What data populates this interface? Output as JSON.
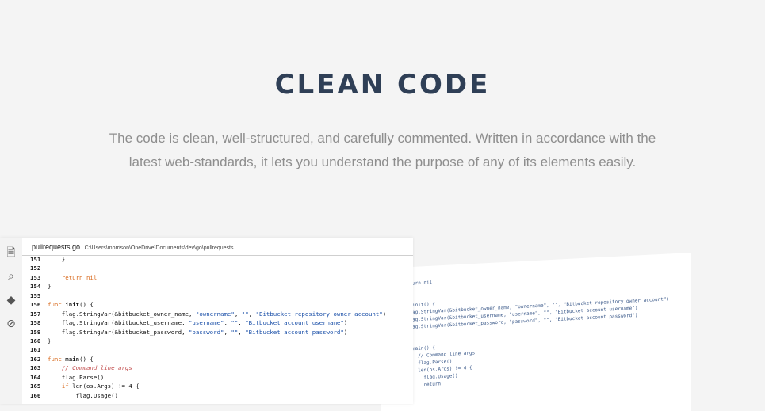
{
  "hero": {
    "title": "CLEAN CODE",
    "description": "The code is clean, well-structured, and carefully commented. Written in accordance with the latest web-standards, it lets you understand the purpose of any of its elements easily."
  },
  "editor": {
    "file_name": "pullrequests.go",
    "file_path": "C:\\Users\\morrison\\OneDrive\\Documents\\dev\\go\\pullrequests",
    "activity_icons": [
      "files-icon",
      "search-icon",
      "git-icon",
      "debug-icon"
    ],
    "lines": [
      {
        "n": "151",
        "tokens": [
          {
            "t": "    }",
            "c": ""
          }
        ]
      },
      {
        "n": "152",
        "tokens": []
      },
      {
        "n": "153",
        "tokens": [
          {
            "t": "    ",
            "c": ""
          },
          {
            "t": "return nil",
            "c": "kw"
          }
        ]
      },
      {
        "n": "154",
        "tokens": [
          {
            "t": "}",
            "c": ""
          }
        ]
      },
      {
        "n": "155",
        "tokens": []
      },
      {
        "n": "156",
        "tokens": [
          {
            "t": "func ",
            "c": "kw"
          },
          {
            "t": "init",
            "c": "fn"
          },
          {
            "t": "() {",
            "c": ""
          }
        ]
      },
      {
        "n": "157",
        "tokens": [
          {
            "t": "    flag.StringVar(&bitbucket_owner_name, ",
            "c": ""
          },
          {
            "t": "\"ownername\"",
            "c": "str"
          },
          {
            "t": ", ",
            "c": ""
          },
          {
            "t": "\"\"",
            "c": "str"
          },
          {
            "t": ", ",
            "c": ""
          },
          {
            "t": "\"Bitbucket repository owner account\"",
            "c": "str"
          },
          {
            "t": ")",
            "c": ""
          }
        ]
      },
      {
        "n": "158",
        "tokens": [
          {
            "t": "    flag.StringVar(&bitbucket_username, ",
            "c": ""
          },
          {
            "t": "\"username\"",
            "c": "str"
          },
          {
            "t": ", ",
            "c": ""
          },
          {
            "t": "\"\"",
            "c": "str"
          },
          {
            "t": ", ",
            "c": ""
          },
          {
            "t": "\"Bitbucket account username\"",
            "c": "str"
          },
          {
            "t": ")",
            "c": ""
          }
        ]
      },
      {
        "n": "159",
        "tokens": [
          {
            "t": "    flag.StringVar(&bitbucket_password, ",
            "c": ""
          },
          {
            "t": "\"password\"",
            "c": "str"
          },
          {
            "t": ", ",
            "c": ""
          },
          {
            "t": "\"\"",
            "c": "str"
          },
          {
            "t": ", ",
            "c": ""
          },
          {
            "t": "\"Bitbucket account password\"",
            "c": "str"
          },
          {
            "t": ")",
            "c": ""
          }
        ]
      },
      {
        "n": "160",
        "tokens": [
          {
            "t": "}",
            "c": ""
          }
        ]
      },
      {
        "n": "161",
        "tokens": []
      },
      {
        "n": "162",
        "tokens": [
          {
            "t": "func ",
            "c": "kw"
          },
          {
            "t": "main",
            "c": "fn"
          },
          {
            "t": "() {",
            "c": ""
          }
        ]
      },
      {
        "n": "163",
        "tokens": [
          {
            "t": "    ",
            "c": ""
          },
          {
            "t": "// Command line args",
            "c": "cm"
          }
        ]
      },
      {
        "n": "164",
        "tokens": [
          {
            "t": "    flag.Parse()",
            "c": ""
          }
        ]
      },
      {
        "n": "165",
        "tokens": [
          {
            "t": "    ",
            "c": ""
          },
          {
            "t": "if ",
            "c": "kw"
          },
          {
            "t": "len(os.Args) != 4 {",
            "c": ""
          }
        ]
      },
      {
        "n": "166",
        "tokens": [
          {
            "t": "        flag.Usage()",
            "c": ""
          }
        ]
      }
    ]
  },
  "back_panel": {
    "lines": [
      "urn nil",
      "",
      "",
      "init() {",
      "ag.StringVar(&bitbucket_owner_name, \"ownername\", \"\", \"Bitbucket repository owner account\")",
      "ag.StringVar(&bitbucket_username, \"username\", \"\", \"Bitbucket account username\")",
      "ag.StringVar(&bitbucket_password, \"password\", \"\", \"Bitbucket account password\")",
      "",
      "",
      "main() {",
      "  // Command line args",
      "  flag.Parse()",
      "  len(os.Args) != 4 {",
      "    flag.Usage()",
      "    return"
    ]
  },
  "colors": {
    "background": "#f4f4f4",
    "title": "#2f3f56",
    "description": "#8e8e8e",
    "keyword": "#d96b1f",
    "string": "#1a4fa8",
    "comment": "#c24c4c"
  }
}
